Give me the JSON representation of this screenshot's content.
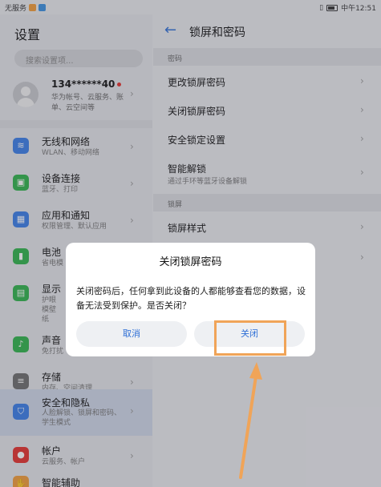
{
  "status_bar": {
    "carrier": "无服务",
    "time": "中午12:51"
  },
  "left": {
    "title": "设置",
    "search_placeholder": "搜索设置项...",
    "account": {
      "name": "134******40",
      "sub": "华为帐号、云服务、账单、云空间等"
    },
    "items": [
      {
        "title": "无线和网络",
        "sub": "WLAN、移动网络",
        "icon": "wifi-icon",
        "color": "#3a7de8"
      },
      {
        "title": "设备连接",
        "sub": "蓝牙、打印",
        "icon": "device-connect-icon",
        "color": "#2eb34a"
      },
      {
        "title": "应用和通知",
        "sub": "权限管理、默认应用",
        "icon": "apps-icon",
        "color": "#3a7de8"
      },
      {
        "title": "电池",
        "sub": "省电模",
        "icon": "battery-icon",
        "color": "#2eb34a"
      },
      {
        "title": "显示",
        "sub": "护眼模壁纸",
        "icon": "display-icon",
        "color": "#2eb34a"
      },
      {
        "title": "声音",
        "sub": "免打扰",
        "icon": "sound-icon",
        "color": "#2eb34a"
      },
      {
        "title": "存储",
        "sub": "内存、空间清理",
        "icon": "storage-icon",
        "color": "#6d6d6d"
      },
      {
        "title": "安全和隐私",
        "sub": "人脸解锁、锁屏和密码、学生模式",
        "icon": "security-icon",
        "color": "#3a7de8"
      },
      {
        "title": "帐户",
        "sub": "云服务、帐户",
        "icon": "account-icon",
        "color": "#e5302b"
      },
      {
        "title": "智能辅助",
        "sub": "",
        "icon": "assist-icon",
        "color": "#f29b38"
      }
    ]
  },
  "right": {
    "title": "锁屏和密码",
    "section_password": "密码",
    "items_password": [
      {
        "label": "更改锁屏密码"
      },
      {
        "label": "关闭锁屏密码"
      },
      {
        "label": "安全锁定设置"
      },
      {
        "label": "智能解锁",
        "sub": "通过手环等蓝牙设备解锁"
      }
    ],
    "section_lock": "锁屏",
    "items_lock": [
      {
        "label": "锁屏样式"
      }
    ]
  },
  "dialog": {
    "title": "关闭锁屏密码",
    "message": "关闭密码后，任何拿到此设备的人都能够查看您的数据，设备无法受到保护。是否关闭？",
    "cancel_label": "取消",
    "confirm_label": "关闭"
  },
  "colors": {
    "accent": "#2f6fd6",
    "annotation": "#f0a458"
  }
}
